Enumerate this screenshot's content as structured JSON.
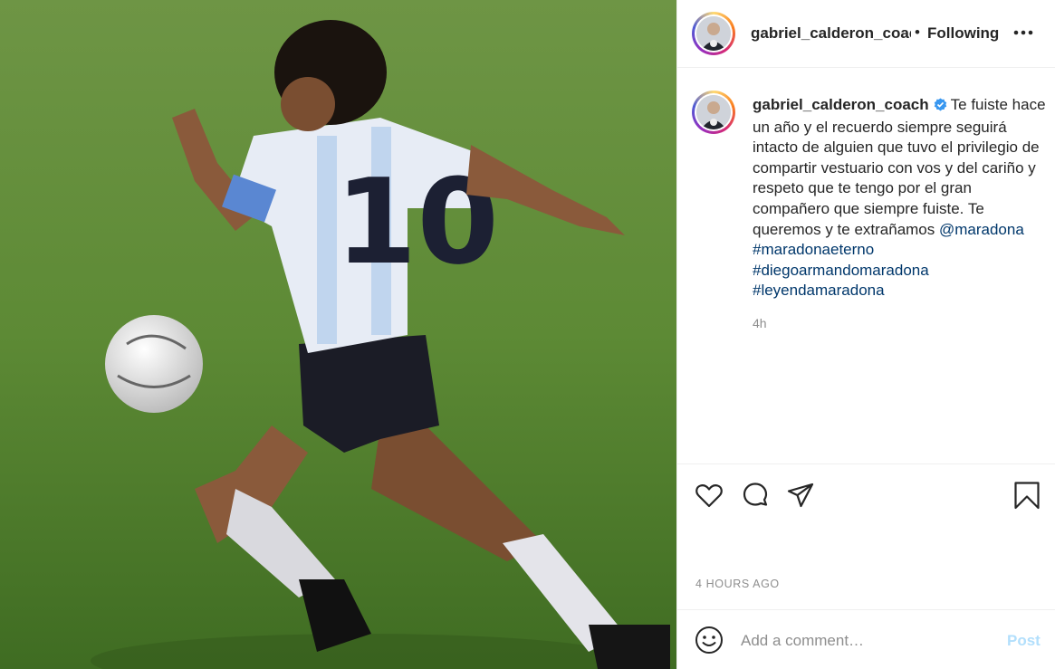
{
  "post": {
    "photo_alt": "Football player in white and light-blue striped shirt with number 10 running with a ball on grass",
    "jersey_number": "10"
  },
  "header": {
    "username": "gabriel_calderon_coach",
    "separator": "•",
    "follow_label": "Following",
    "more_icon": "more-dots-icon"
  },
  "caption": {
    "username": "gabriel_calderon_coach",
    "text": "Te fuiste hace un año y el recuerdo siempre seguirá intacto de alguien que tuvo el privilegio de compartir vestuario con vos y del cariño y respeto que te tengo por el gran compañero que siempre fuiste. Te queremos y te extrañamos ",
    "mention": "@maradona",
    "hashtags": [
      "#maradonaeterno",
      "#diegoarmandomaradona",
      "#leyendamaradona"
    ],
    "time_ago": "4h"
  },
  "actions": {
    "like_icon": "heart-icon",
    "comment_icon": "comment-bubble-icon",
    "share_icon": "paper-plane-icon",
    "save_icon": "bookmark-icon"
  },
  "timestamp": "4 HOURS AGO",
  "comment": {
    "placeholder": "Add a comment…",
    "post_label": "Post",
    "emoji_icon": "smiley-icon"
  },
  "colors": {
    "link": "#00376b",
    "muted": "#8e8e8e",
    "post_disabled": "#b2dffc",
    "verified": "#3897f0"
  }
}
